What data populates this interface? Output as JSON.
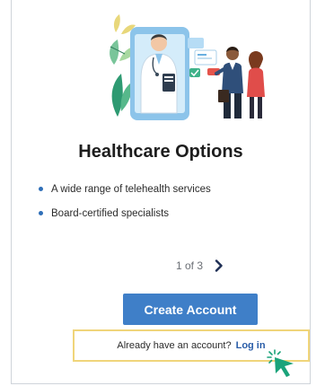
{
  "card": {
    "title": "Healthcare Options",
    "features": [
      "A wide range of telehealth services",
      "Board-certified specialists"
    ]
  },
  "pager": {
    "text": "1 of 3",
    "next_icon": "chevron-right-icon"
  },
  "actions": {
    "create_account_label": "Create Account",
    "login_prompt": "Already have an account?",
    "login_link": "Log in"
  },
  "colors": {
    "accent": "#3f7fc8",
    "link": "#2a5da8",
    "highlight_border": "#f0d57a",
    "cursor": "#1aa37a",
    "bullet": "#2f6fb8"
  }
}
